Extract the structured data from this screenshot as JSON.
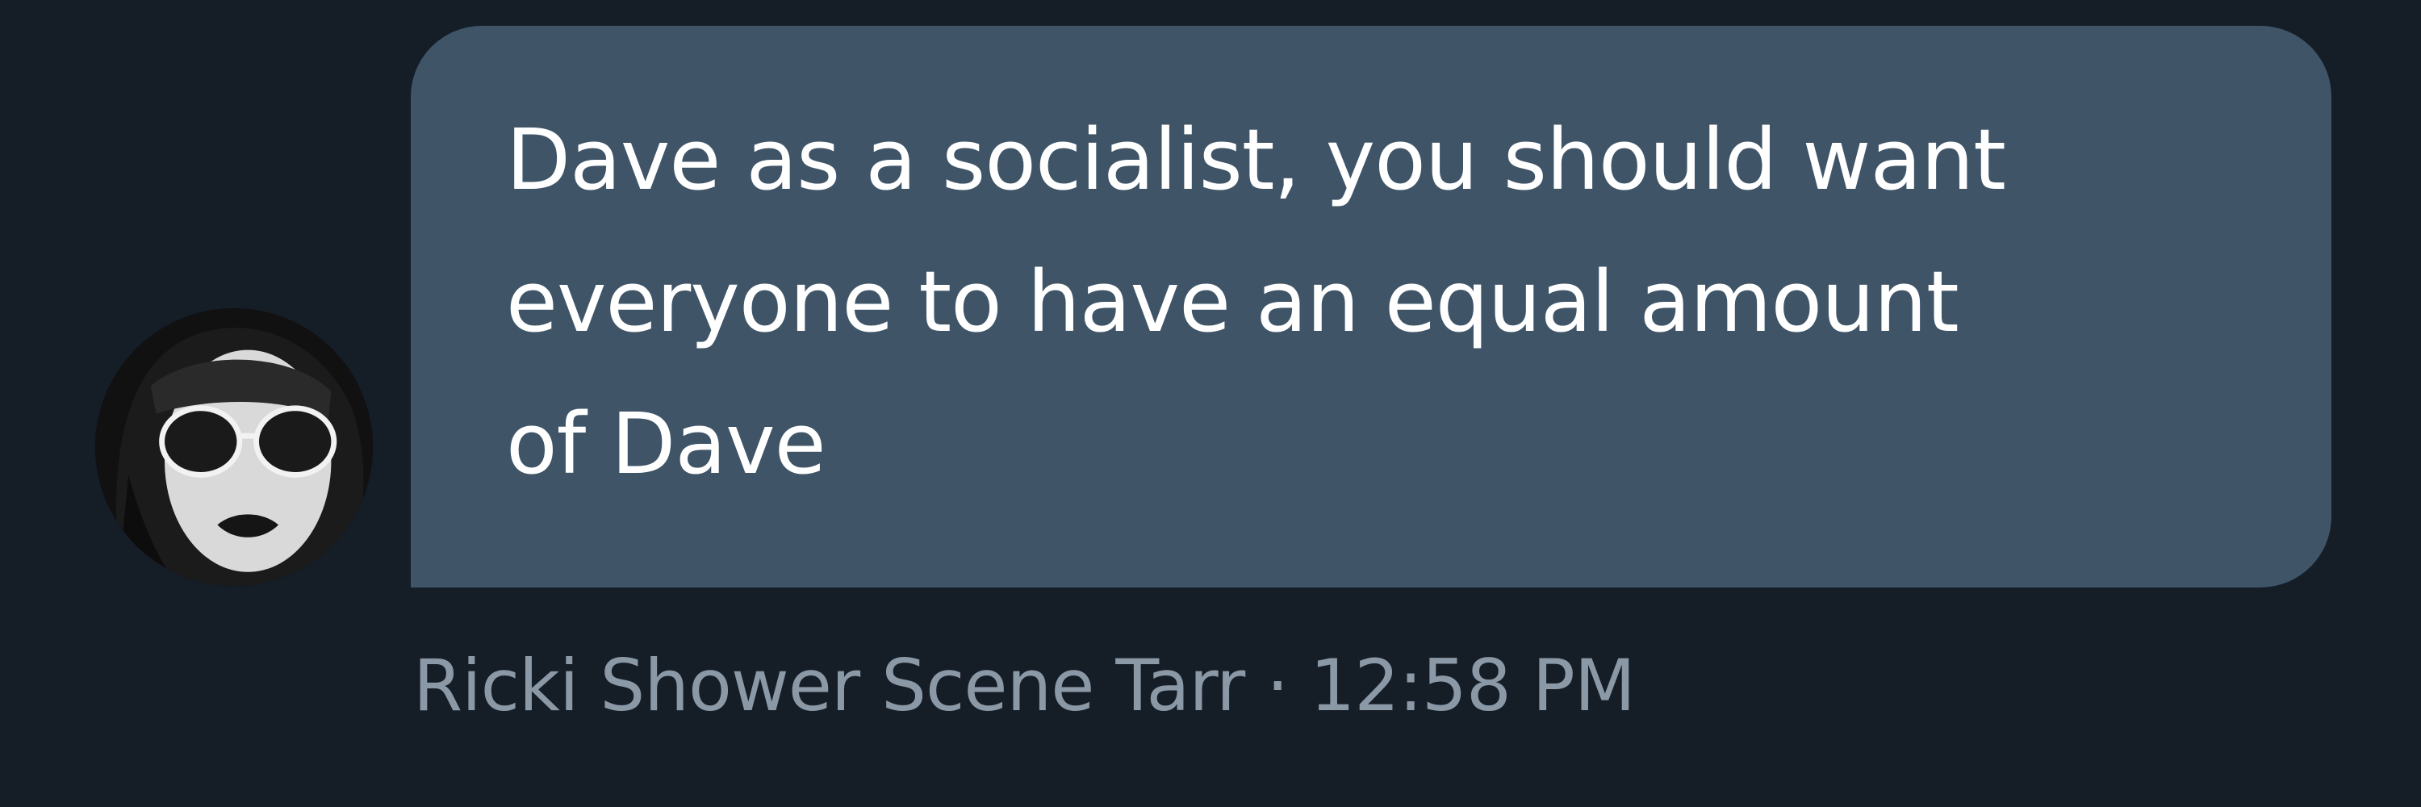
{
  "message": {
    "text": "Dave as a socialist, you should want\neveryone to have an equal amount\nof Dave",
    "sender": "Ricki Shower Scene Tarr",
    "separator": " · ",
    "time": "12:58 PM"
  },
  "avatar": {
    "icon": "profile-photo"
  },
  "colors": {
    "background": "#151d27",
    "bubble": "#3f5467",
    "text": "#ffffff",
    "meta": "#8b98a6"
  }
}
